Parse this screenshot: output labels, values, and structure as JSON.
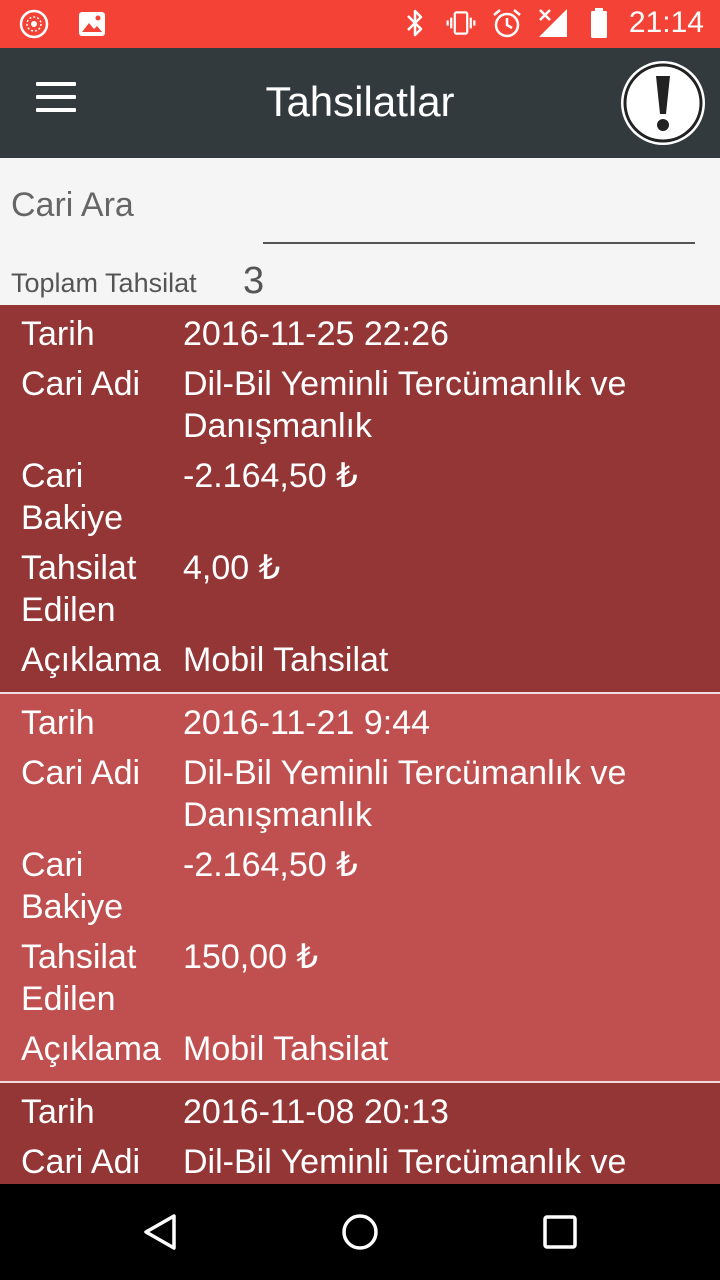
{
  "status_bar": {
    "time": "21:14"
  },
  "toolbar": {
    "title": "Tahsilatlar",
    "menu_icon": "hamburger-menu-icon",
    "action_icon": "exclamation-alert-icon"
  },
  "search": {
    "label": "Cari Ara",
    "value": ""
  },
  "summary": {
    "label": "Toplam Tahsilat",
    "count": "3"
  },
  "records": [
    {
      "tarih_label": "Tarih",
      "tarih": "2016-11-25 22:26",
      "cari_adi_label": "Cari Adi",
      "cari_adi": "Dil-Bil Yeminli Tercümanlık ve Danışmanlık",
      "cari_bakiye_label_1": "Cari",
      "cari_bakiye_label_2": "Bakiye",
      "cari_bakiye": "-2.164,50 ₺",
      "tahsilat_label_1": "Tahsilat",
      "tahsilat_label_2": "Edilen",
      "tahsilat": "4,00 ₺",
      "aciklama_label": "Açıklama",
      "aciklama": "Mobil Tahsilat"
    },
    {
      "tarih_label": "Tarih",
      "tarih": "2016-11-21 9:44",
      "cari_adi_label": "Cari Adi",
      "cari_adi": "Dil-Bil Yeminli Tercümanlık ve Danışmanlık",
      "cari_bakiye_label_1": "Cari",
      "cari_bakiye_label_2": "Bakiye",
      "cari_bakiye": "-2.164,50 ₺",
      "tahsilat_label_1": "Tahsilat",
      "tahsilat_label_2": "Edilen",
      "tahsilat": "150,00 ₺",
      "aciklama_label": "Açıklama",
      "aciklama": "Mobil Tahsilat"
    },
    {
      "tarih_label": "Tarih",
      "tarih": "2016-11-08 20:13",
      "cari_adi_label": "Cari Adi",
      "cari_adi": "Dil-Bil Yeminli Tercümanlık ve Danışmanlık"
    }
  ],
  "colors": {
    "status_bar": "#f44336",
    "toolbar": "#323a3e",
    "row_dark": "#943636",
    "row_light": "#c05050"
  }
}
